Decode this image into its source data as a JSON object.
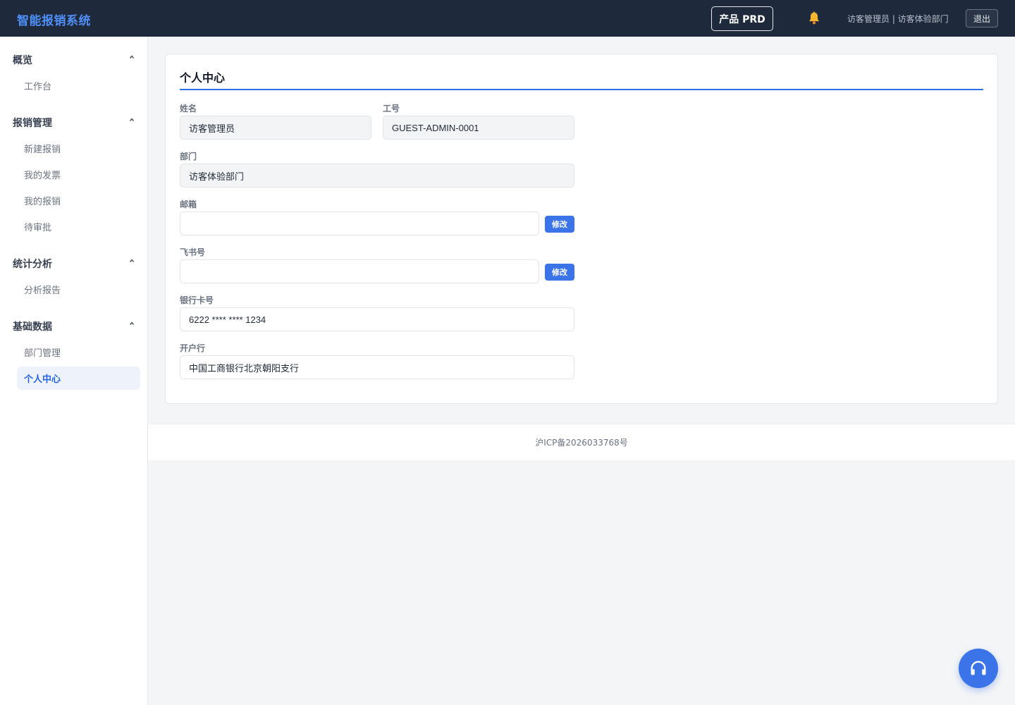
{
  "header": {
    "app_title": "智能报销系统",
    "prd_button": "产品 PRD",
    "bell_icon": "bell-icon",
    "user_info": "访客管理员 | 访客体验部门",
    "logout_button": "退出"
  },
  "sidebar": {
    "groups": [
      {
        "title": "概览",
        "items": [
          {
            "label": "工作台"
          }
        ]
      },
      {
        "title": "报销管理",
        "items": [
          {
            "label": "新建报销"
          },
          {
            "label": "我的发票"
          },
          {
            "label": "我的报销"
          },
          {
            "label": "待审批"
          }
        ]
      },
      {
        "title": "统计分析",
        "items": [
          {
            "label": "分析报告"
          }
        ]
      },
      {
        "title": "基础数据",
        "items": [
          {
            "label": "部门管理"
          },
          {
            "label": "个人中心",
            "active": true
          }
        ]
      }
    ]
  },
  "profile": {
    "title": "个人中心",
    "name_label": "姓名",
    "name_value": "访客管理员",
    "employee_id_label": "工号",
    "employee_id_value": "GUEST-ADMIN-0001",
    "department_label": "部门",
    "department_value": "访客体验部门",
    "email_label": "邮箱",
    "email_value": "",
    "email_edit_button": "修改",
    "feishu_label": "飞书号",
    "feishu_value": "",
    "feishu_edit_button": "修改",
    "bank_card_label": "银行卡号",
    "bank_card_value": "6222 **** **** 1234",
    "bank_label": "开户行",
    "bank_value": "中国工商银行北京朝阳支行"
  },
  "footer": {
    "icp": "沪ICP备2026033768号"
  },
  "floating": {
    "support_icon": "headphones-icon"
  },
  "colors": {
    "header_bg": "#1e2a3b",
    "accent": "#3b74e8",
    "title_blue": "#4f8ff7"
  }
}
